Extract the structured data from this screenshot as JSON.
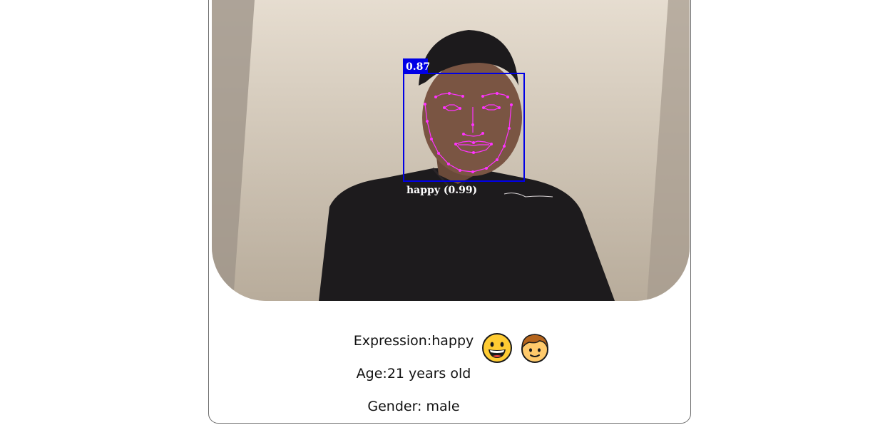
{
  "detection": {
    "score": "0.87",
    "expression_label": "happy (0.99)",
    "box_color": "#0000e6",
    "landmark_color": "#ff33ff"
  },
  "stats": {
    "expression": "Expression:happy",
    "age": "Age:21 years old",
    "gender": "Gender: male"
  },
  "icons": {
    "expression_emoji": "grinning-face-icon",
    "gender_emoji": "boy-face-icon"
  }
}
